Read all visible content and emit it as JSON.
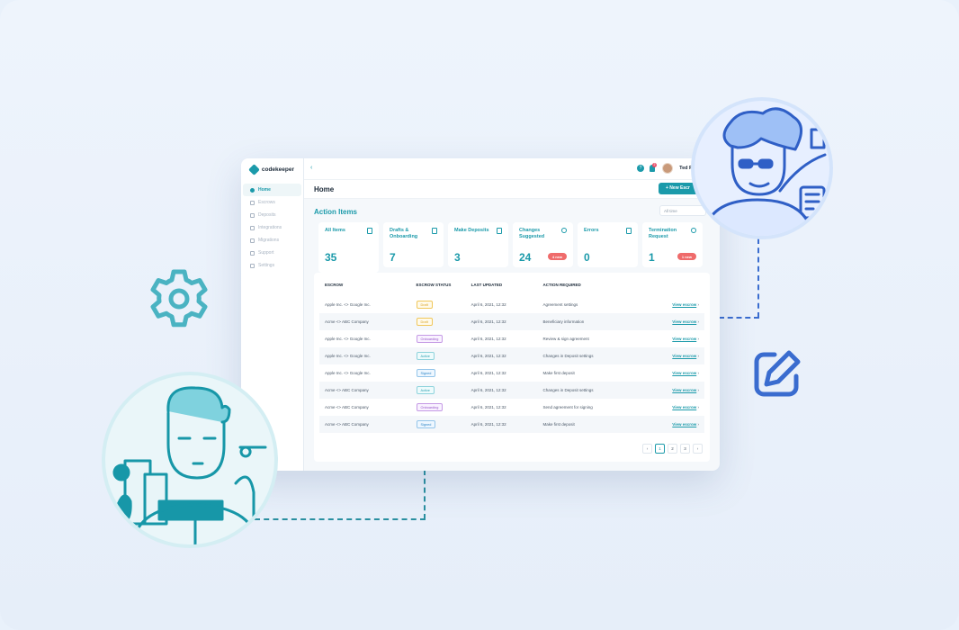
{
  "app": {
    "logo_text": "codekeeper"
  },
  "topbar": {
    "user_name": "Ted R",
    "notification_count": "2",
    "help_glyph": "?"
  },
  "header": {
    "page_title": "Home",
    "new_button": "+ New Escr"
  },
  "action_items": {
    "title": "Action Items",
    "filter_placeholder": "All time"
  },
  "sidebar": {
    "items": [
      {
        "label": "Home",
        "active": true
      },
      {
        "label": "Escrows"
      },
      {
        "label": "Deposits"
      },
      {
        "label": "Integrations"
      },
      {
        "label": "Migrations"
      },
      {
        "label": "Support"
      },
      {
        "label": "Settings"
      }
    ]
  },
  "cards": [
    {
      "label": "All Items",
      "value": "35",
      "icon": "document-icon"
    },
    {
      "label": "Drafts & Onboarding",
      "value": "7",
      "icon": "edit-icon"
    },
    {
      "label": "Make Deposits",
      "value": "3",
      "icon": "folder-icon"
    },
    {
      "label": "Changes Suggested",
      "value": "24",
      "icon": "settings-icon",
      "badge": "4 new"
    },
    {
      "label": "Errors",
      "value": "0",
      "icon": "warning-icon"
    },
    {
      "label": "Termination Request",
      "value": "1",
      "icon": "close-circle-icon",
      "badge": "1 new"
    }
  ],
  "table": {
    "headers": [
      "ESCROW",
      "ESCROW STATUS",
      "LAST UPDATED",
      "ACTION REQUIRED"
    ],
    "rows": [
      {
        "escrow": "Apple Inc. <> Google Inc.",
        "status": "Draft",
        "updated": "April 6, 2021, 12:32",
        "action": "Agreement settings",
        "link": "View escrow"
      },
      {
        "escrow": "Acme <> ABC Company",
        "status": "Draft",
        "updated": "April 6, 2021, 12:32",
        "action": "Beneficiary information",
        "link": "View escrow"
      },
      {
        "escrow": "Apple Inc. <> Google Inc.",
        "status": "Onboarding",
        "updated": "April 6, 2021, 12:32",
        "action": "Review & sign agreement",
        "link": "View escrow"
      },
      {
        "escrow": "Apple Inc. <> Google Inc.",
        "status": "Active",
        "updated": "April 6, 2021, 12:32",
        "action": "Changes in Deposit settings",
        "link": "View escrow"
      },
      {
        "escrow": "Apple Inc. <> Google Inc.",
        "status": "Signed",
        "updated": "April 6, 2021, 12:32",
        "action": "Make first deposit",
        "link": "View escrow"
      },
      {
        "escrow": "Acme <> ABC Company",
        "status": "Active",
        "updated": "April 6, 2021, 12:32",
        "action": "Changes in Deposit settings",
        "link": "View escrow"
      },
      {
        "escrow": "Acme <> ABC Company",
        "status": "Onboarding",
        "updated": "April 6, 2021, 12:32",
        "action": "Send agreement for signing",
        "link": "View escrow"
      },
      {
        "escrow": "Acme <> ABC Company",
        "status": "Signed",
        "updated": "April 6, 2021, 12:32",
        "action": "Make first deposit",
        "link": "View escrow"
      }
    ]
  },
  "pagination": {
    "pages": [
      "1",
      "2",
      "3"
    ],
    "current": "1"
  },
  "colors": {
    "accent": "#1b9aaa",
    "badge_red": "#ef6b6b",
    "pen_blue": "#3a6ccf"
  }
}
